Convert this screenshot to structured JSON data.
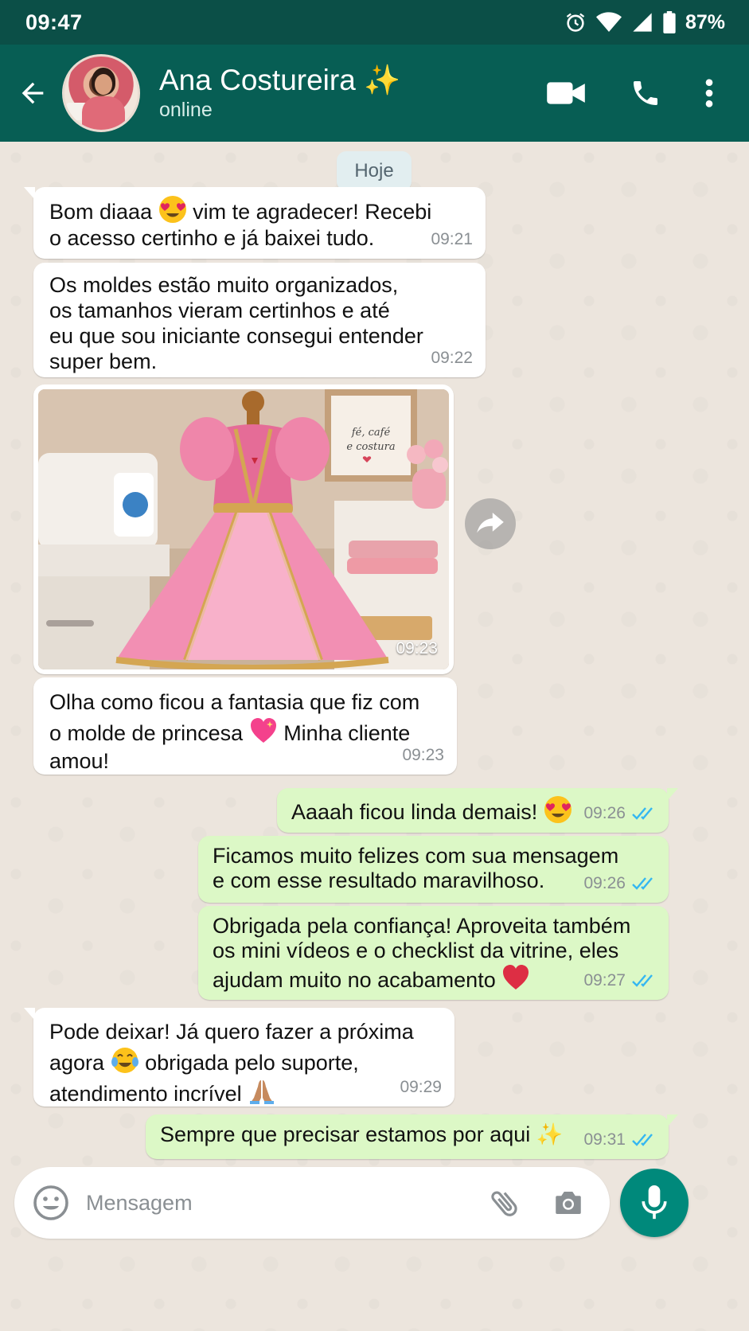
{
  "status_bar": {
    "time": "09:47",
    "battery": "87%"
  },
  "header": {
    "contact_name": "Ana Costureira ✨",
    "contact_status": "online",
    "icons": [
      "back-arrow-icon",
      "video-call-icon",
      "phone-icon",
      "more-vert-icon"
    ]
  },
  "chat": {
    "date_label": "Hoje",
    "messages": [
      {
        "dir": "in",
        "text_a": "Bom diaaa",
        "text_b": "vim te agradecer! Recebi\no acesso certinho e já baixei tudo.",
        "time": "09:21"
      },
      {
        "dir": "in",
        "text": "Os moldes estão muito organizados,\nos tamanhos vieram certinhos e até\neu que sou iniciante consegui entender\nsuper bem.",
        "time": "09:22"
      },
      {
        "dir": "in",
        "type": "image",
        "time": "09:23",
        "image_text": "fé, café\ne costura"
      },
      {
        "dir": "in",
        "text_a": "Olha como ficou a fantasia que fiz com\no molde de princesa",
        "text_b": "Minha cliente\namou!",
        "time": "09:23"
      },
      {
        "dir": "out",
        "text": "Aaaah ficou linda demais!",
        "time": "09:26"
      },
      {
        "dir": "out",
        "text": "Ficamos muito felizes com sua mensagem\ne com esse resultado maravilhoso.",
        "time": "09:26"
      },
      {
        "dir": "out",
        "text": "Obrigada pela confiança! Aproveita também\nos mini vídeos e o checklist da vitrine, eles\najudam muito no acabamento",
        "time": "09:27"
      },
      {
        "dir": "in",
        "text_a": "Pode deixar! Já quero fazer a próxima\nagora",
        "text_b": "obrigada pelo suporte,\natendimento incrível",
        "time": "09:29"
      },
      {
        "dir": "out",
        "text": "Sempre que precisar estamos por aqui ✨",
        "time": "09:31"
      }
    ]
  },
  "composer": {
    "placeholder": "Mensagem"
  },
  "colors": {
    "header": "#075e54",
    "status_bar": "#0b4f47",
    "outgoing": "#dcf8c6",
    "incoming": "#ffffff",
    "read_ticks": "#34b7f1",
    "fab": "#00897b"
  }
}
